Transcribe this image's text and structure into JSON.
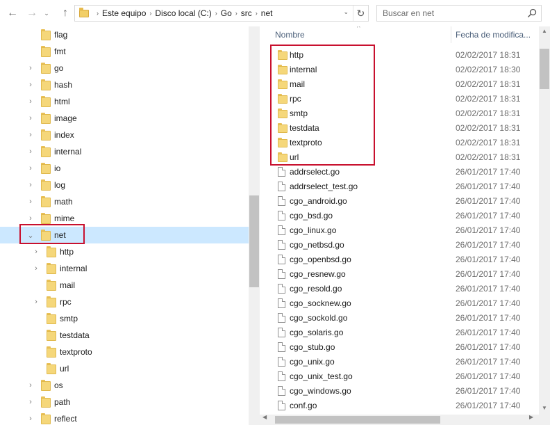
{
  "navigation": {
    "back_glyph": "←",
    "forward_glyph": "→",
    "recent_glyph": "⌄",
    "up_glyph": "↑",
    "refresh_glyph": "↻",
    "dropdown_glyph": "⌄",
    "crumb_separator": "›"
  },
  "address_bar": {
    "crumbs": [
      "Este equipo",
      "Disco local (C:)",
      "Go",
      "src",
      "net"
    ]
  },
  "search": {
    "placeholder": "Buscar en net"
  },
  "tree": {
    "collapsed_glyph": "›",
    "expanded_glyph": "⌄",
    "items": [
      {
        "label": "flag",
        "depth": 0,
        "chevron": "none"
      },
      {
        "label": "fmt",
        "depth": 0,
        "chevron": "none"
      },
      {
        "label": "go",
        "depth": 0,
        "chevron": "collapsed"
      },
      {
        "label": "hash",
        "depth": 0,
        "chevron": "collapsed"
      },
      {
        "label": "html",
        "depth": 0,
        "chevron": "collapsed"
      },
      {
        "label": "image",
        "depth": 0,
        "chevron": "collapsed"
      },
      {
        "label": "index",
        "depth": 0,
        "chevron": "collapsed"
      },
      {
        "label": "internal",
        "depth": 0,
        "chevron": "collapsed"
      },
      {
        "label": "io",
        "depth": 0,
        "chevron": "collapsed"
      },
      {
        "label": "log",
        "depth": 0,
        "chevron": "collapsed"
      },
      {
        "label": "math",
        "depth": 0,
        "chevron": "collapsed"
      },
      {
        "label": "mime",
        "depth": 0,
        "chevron": "collapsed"
      },
      {
        "label": "net",
        "depth": 0,
        "chevron": "expanded",
        "selected": true
      },
      {
        "label": "http",
        "depth": 1,
        "chevron": "collapsed"
      },
      {
        "label": "internal",
        "depth": 1,
        "chevron": "collapsed"
      },
      {
        "label": "mail",
        "depth": 1,
        "chevron": "none"
      },
      {
        "label": "rpc",
        "depth": 1,
        "chevron": "collapsed"
      },
      {
        "label": "smtp",
        "depth": 1,
        "chevron": "none"
      },
      {
        "label": "testdata",
        "depth": 1,
        "chevron": "none"
      },
      {
        "label": "textproto",
        "depth": 1,
        "chevron": "none"
      },
      {
        "label": "url",
        "depth": 1,
        "chevron": "none"
      },
      {
        "label": "os",
        "depth": 0,
        "chevron": "collapsed"
      },
      {
        "label": "path",
        "depth": 0,
        "chevron": "collapsed"
      },
      {
        "label": "reflect",
        "depth": 0,
        "chevron": "collapsed"
      }
    ]
  },
  "columns": {
    "name": "Nombre",
    "date": "Fecha de modifica...",
    "sort_glyph": "^"
  },
  "files": [
    {
      "name": "http",
      "date": "02/02/2017 18:31",
      "type": "folder"
    },
    {
      "name": "internal",
      "date": "02/02/2017 18:30",
      "type": "folder"
    },
    {
      "name": "mail",
      "date": "02/02/2017 18:31",
      "type": "folder"
    },
    {
      "name": "rpc",
      "date": "02/02/2017 18:31",
      "type": "folder"
    },
    {
      "name": "smtp",
      "date": "02/02/2017 18:31",
      "type": "folder"
    },
    {
      "name": "testdata",
      "date": "02/02/2017 18:31",
      "type": "folder"
    },
    {
      "name": "textproto",
      "date": "02/02/2017 18:31",
      "type": "folder"
    },
    {
      "name": "url",
      "date": "02/02/2017 18:31",
      "type": "folder"
    },
    {
      "name": "addrselect.go",
      "date": "26/01/2017 17:40",
      "type": "file"
    },
    {
      "name": "addrselect_test.go",
      "date": "26/01/2017 17:40",
      "type": "file"
    },
    {
      "name": "cgo_android.go",
      "date": "26/01/2017 17:40",
      "type": "file"
    },
    {
      "name": "cgo_bsd.go",
      "date": "26/01/2017 17:40",
      "type": "file"
    },
    {
      "name": "cgo_linux.go",
      "date": "26/01/2017 17:40",
      "type": "file"
    },
    {
      "name": "cgo_netbsd.go",
      "date": "26/01/2017 17:40",
      "type": "file"
    },
    {
      "name": "cgo_openbsd.go",
      "date": "26/01/2017 17:40",
      "type": "file"
    },
    {
      "name": "cgo_resnew.go",
      "date": "26/01/2017 17:40",
      "type": "file"
    },
    {
      "name": "cgo_resold.go",
      "date": "26/01/2017 17:40",
      "type": "file"
    },
    {
      "name": "cgo_socknew.go",
      "date": "26/01/2017 17:40",
      "type": "file"
    },
    {
      "name": "cgo_sockold.go",
      "date": "26/01/2017 17:40",
      "type": "file"
    },
    {
      "name": "cgo_solaris.go",
      "date": "26/01/2017 17:40",
      "type": "file"
    },
    {
      "name": "cgo_stub.go",
      "date": "26/01/2017 17:40",
      "type": "file"
    },
    {
      "name": "cgo_unix.go",
      "date": "26/01/2017 17:40",
      "type": "file"
    },
    {
      "name": "cgo_unix_test.go",
      "date": "26/01/2017 17:40",
      "type": "file"
    },
    {
      "name": "cgo_windows.go",
      "date": "26/01/2017 17:40",
      "type": "file"
    },
    {
      "name": "conf.go",
      "date": "26/01/2017 17:40",
      "type": "file"
    }
  ],
  "scroll_glyphs": {
    "up": "▲",
    "down": "▼",
    "left": "◀",
    "right": "▶"
  },
  "colors": {
    "selection": "#cce8ff",
    "highlight_box": "#c8102e",
    "folder": "#f5d77a",
    "header_text": "#4c607a"
  }
}
